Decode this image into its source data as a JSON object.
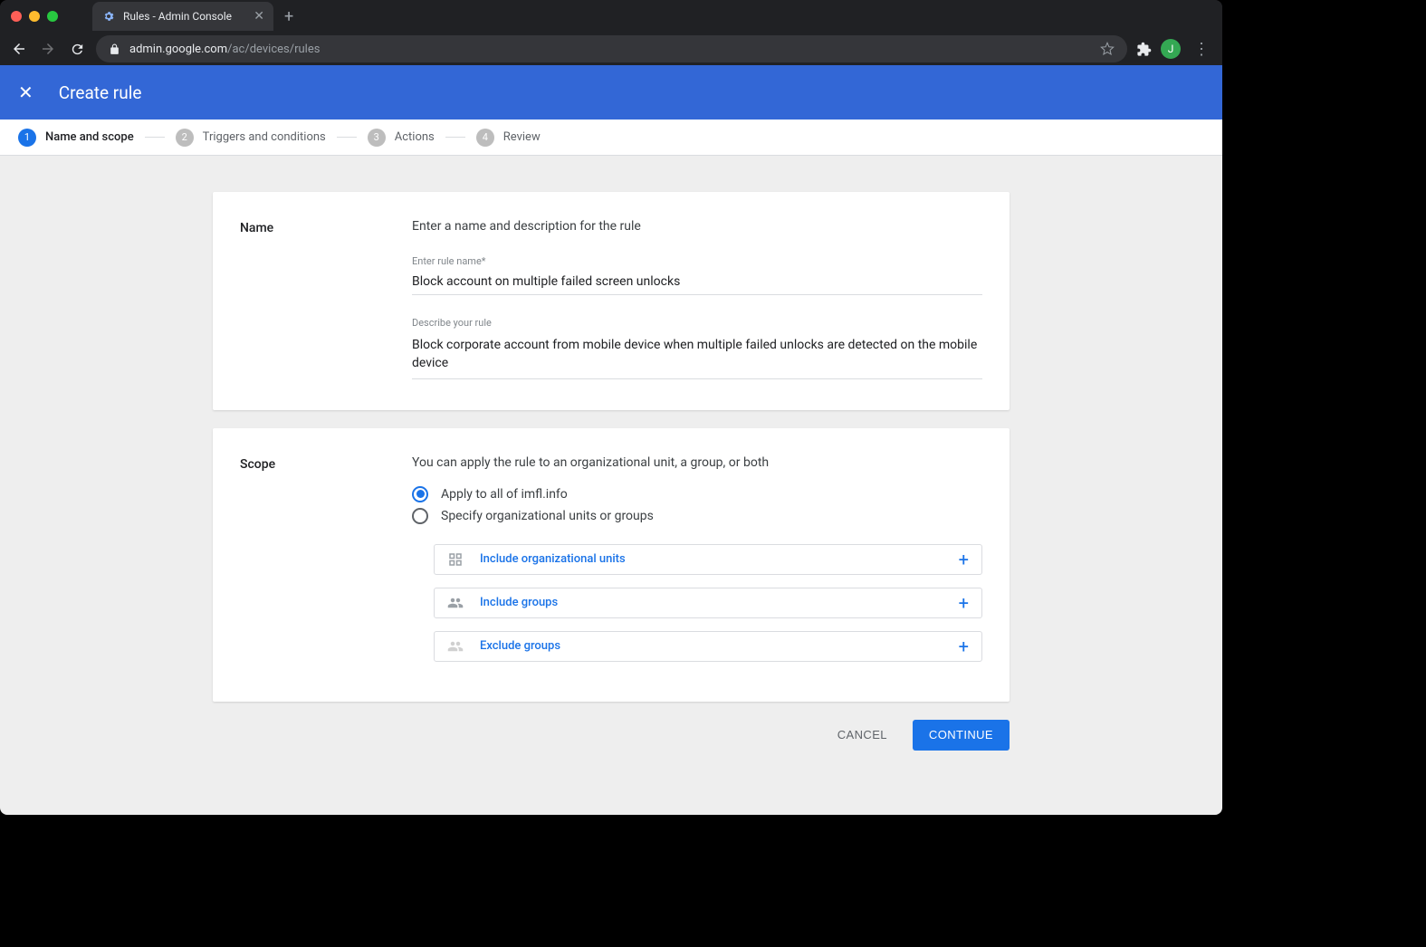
{
  "browser": {
    "tab_title": "Rules - Admin Console",
    "url_host": "admin.google.com",
    "url_path": "/ac/devices/rules",
    "avatar_initial": "J"
  },
  "appbar": {
    "title": "Create rule"
  },
  "steps": [
    {
      "num": "1",
      "label": "Name and scope",
      "active": true
    },
    {
      "num": "2",
      "label": "Triggers and conditions",
      "active": false
    },
    {
      "num": "3",
      "label": "Actions",
      "active": false
    },
    {
      "num": "4",
      "label": "Review",
      "active": false
    }
  ],
  "name_card": {
    "heading": "Name",
    "hint": "Enter a name and description for the rule",
    "name_label": "Enter rule name*",
    "name_value": "Block account on multiple failed screen unlocks",
    "desc_label": "Describe your rule",
    "desc_value": "Block corporate account from mobile device when multiple failed unlocks are detected on the mobile device"
  },
  "scope_card": {
    "heading": "Scope",
    "hint": "You can apply the rule to an organizational unit, a group, or both",
    "option_all": "Apply to all of imfl.info",
    "option_specify": "Specify organizational units or groups",
    "selected": "all",
    "include_org": "Include organizational units",
    "include_groups": "Include groups",
    "exclude_groups": "Exclude groups"
  },
  "buttons": {
    "cancel": "CANCEL",
    "continue": "CONTINUE"
  }
}
